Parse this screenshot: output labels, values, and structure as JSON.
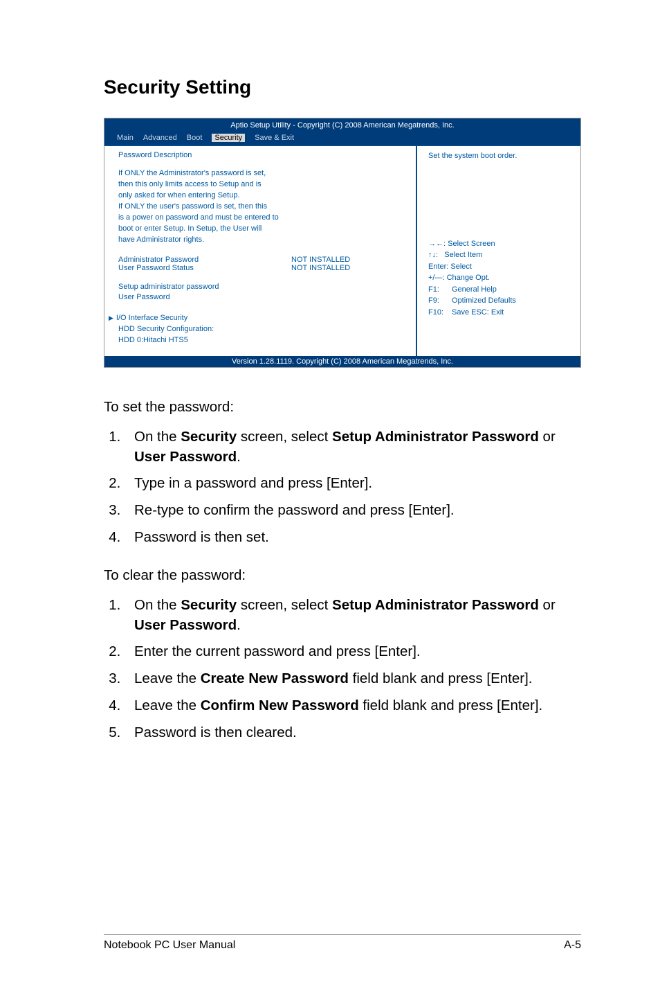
{
  "heading": "Security Setting",
  "bios": {
    "top": "Aptio Setup Utility - Copyright (C) 2008 American Megatrends, Inc.",
    "menu": {
      "main": "Main",
      "advanced": "Advanced",
      "boot": "Boot",
      "security": "Security",
      "save": "Save & Exit"
    },
    "left": {
      "pd_title": "Password Description",
      "desc1": "If ONLY the Administrator's password is set,",
      "desc2": "then this only limits access to Setup and is",
      "desc3": "only asked for when entering Setup.",
      "desc4": "If ONLY the user's password is set, then this",
      "desc5": "is a power on password and must be entered to",
      "desc6": "boot or enter Setup. In Setup, the User will",
      "desc7": "have Administrator rights.",
      "admin_pw_k": "Administrator Password",
      "admin_pw_v": "NOT INSTALLED",
      "user_pw_k": "User Password Status",
      "user_pw_v": "NOT INSTALLED",
      "setup_admin": "Setup administrator password",
      "user_pw": "User Password",
      "io": "I/O Interface Security",
      "hdd_conf": "HDD Security Configuration:",
      "hdd0": "HDD 0:Hitachi HTS5"
    },
    "right": {
      "help": "Set the system boot order.",
      "n1": "Select Screen",
      "n2": "Select Item",
      "n3": "Enter: Select",
      "n4": "+/—:  Change Opt.",
      "n5": "General Help",
      "n6": "Optimized Defaults",
      "n7": "Save    ESC: Exit",
      "k5": "F1:",
      "k6": "F9:",
      "k7": "F10:"
    },
    "footer": "Version 1.28.1119. Copyright (C) 2008 American Megatrends, Inc."
  },
  "body": {
    "set_intro": "To set the password:",
    "set1a": "On the ",
    "set1b": "Security",
    "set1c": " screen, select ",
    "set1d": "Setup Administrator Password",
    "set1e": " or ",
    "set1f": "User Password",
    "set1g": ".",
    "set2": "Type in a password and press [Enter].",
    "set3": "Re-type to confirm the password and press [Enter].",
    "set4": "Password is then set.",
    "clear_intro": "To clear the password:",
    "clr1a": "On the ",
    "clr1b": "Security",
    "clr1c": " screen, select ",
    "clr1d": "Setup Administrator Password",
    "clr1e": " or ",
    "clr1f": "User Password",
    "clr1g": ".",
    "clr2": "Enter the current password and press [Enter].",
    "clr3a": "Leave the ",
    "clr3b": "Create New Password",
    "clr3c": " field blank and press [Enter].",
    "clr4a": "Leave the ",
    "clr4b": "Confirm New Password",
    "clr4c": " field blank and press [Enter].",
    "clr5": "Password is then cleared."
  },
  "footer": {
    "left": "Notebook PC User Manual",
    "right": "A-5"
  }
}
